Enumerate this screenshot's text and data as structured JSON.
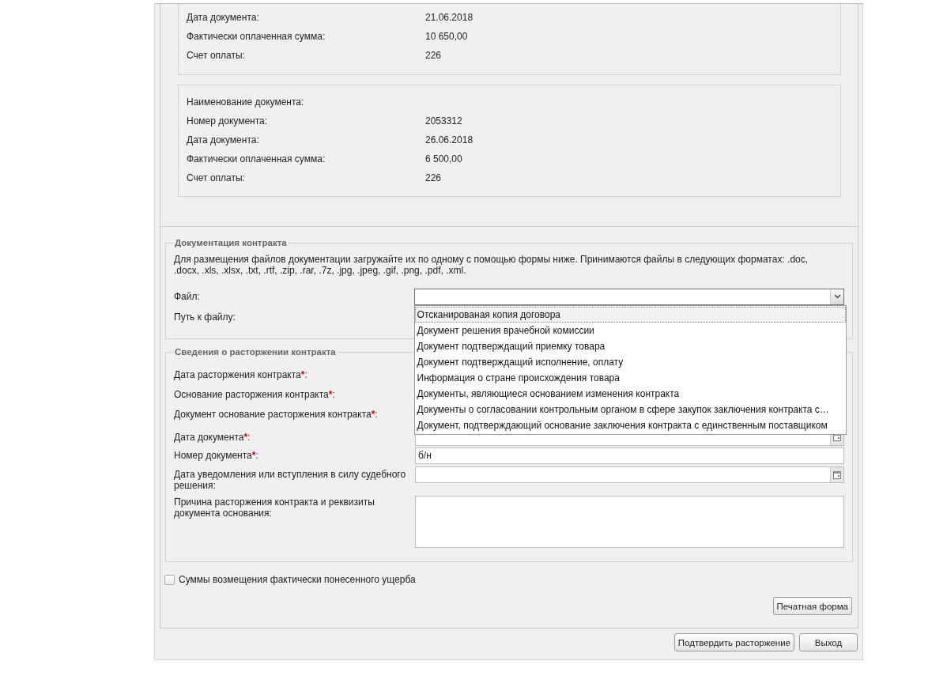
{
  "payment_documents": [
    {
      "rows": [
        {
          "label": "Дата документа:",
          "value": "21.06.2018"
        },
        {
          "label": "Фактически оплаченная сумма:",
          "value": "10 650,00"
        },
        {
          "label": "Счет оплаты:",
          "value": "226"
        }
      ]
    },
    {
      "rows": [
        {
          "label": "Наименование документа:"
        },
        {
          "label": "Номер документа:",
          "value": "2053312"
        },
        {
          "label": "Дата документа:",
          "value": "26.06.2018"
        },
        {
          "label": "Фактически оплаченная сумма:",
          "value": "6 500,00"
        },
        {
          "label": "Счет оплаты:",
          "value": "226"
        }
      ]
    }
  ],
  "documentation": {
    "legend": "Документация контракта",
    "description": "Для размещения файлов документации загружайте их по одному с помощью формы ниже. Принимаются файлы в следующих форматах: .doc, .docx, .xls, .xlsx, .txt, .rtf, .zip, .rar, .7z, .jpg, .jpeg, .gif, .png, .pdf, .xml.",
    "file_label": "Файл:",
    "path_label": "Путь к файлу:",
    "file_dropdown": {
      "expanded": true,
      "options": [
        {
          "label": "Отсканированая копия договора",
          "selected": true
        },
        {
          "label": "Документ решения врачебной комиссии",
          "selected": false
        },
        {
          "label": "Документ подтверждащий приемку товара",
          "selected": false
        },
        {
          "label": "Документ подтверждащий исполнение, оплату",
          "selected": false
        },
        {
          "label": "Информация о стране происхождения товара",
          "selected": false
        },
        {
          "label": "Документы, являющиеся основанием изменения контракта",
          "selected": false
        },
        {
          "label": "Документы о согласовании контрольным органом в сфере закупок заключения контракта с…",
          "selected": false
        },
        {
          "label": "Документ, подтверждающий основание заключения контракта с единственным поставщиком",
          "selected": false
        }
      ]
    }
  },
  "termination": {
    "legend": "Сведения о расторжении контракта",
    "required_mark": "*",
    "label_suffix": ":",
    "fields": [
      {
        "label": "Дата расторжения контракта",
        "required": true,
        "kind": "covered"
      },
      {
        "label": "Основание расторжения контракта",
        "required": true,
        "kind": "covered"
      },
      {
        "label": "Документ основание расторжения контракта",
        "required": true,
        "kind": "covered"
      },
      {
        "label": "Дата документа",
        "required": true,
        "kind": "date"
      },
      {
        "label": "Номер документа",
        "required": true,
        "kind": "text",
        "value": "б/н"
      },
      {
        "label": "Дата уведомления или вступления в силу судебного решения",
        "required": false,
        "kind": "date"
      },
      {
        "label": "Причина расторжения контракта и реквизиты документа основания",
        "required": false,
        "kind": "textarea"
      }
    ]
  },
  "damages_checkbox": {
    "label": "Суммы возмещения фактически понесенного ущерба",
    "checked": false
  },
  "print_button": "Печатная форма",
  "footer_buttons": [
    "Подтвердить расторжение",
    "Выход"
  ]
}
